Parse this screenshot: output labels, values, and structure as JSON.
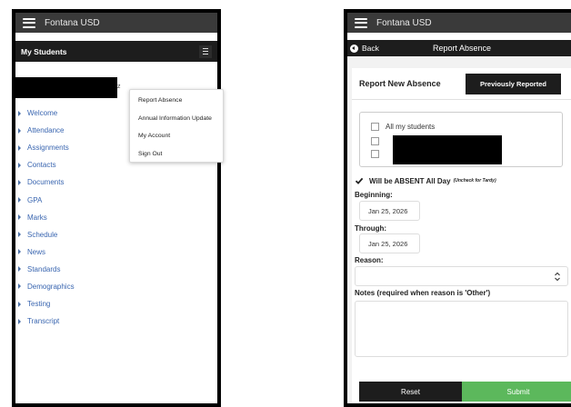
{
  "app": {
    "title": "Fontana USD"
  },
  "left": {
    "header_title": "My Students",
    "redacted_trailing_char": "z",
    "nav_items": [
      "Welcome",
      "Attendance",
      "Assignments",
      "Contacts",
      "Documents",
      "GPA",
      "Marks",
      "Schedule",
      "News",
      "Standards",
      "Demographics",
      "Testing",
      "Transcript"
    ],
    "dropdown_items": [
      "Report Absence",
      "Annual Information Update",
      "My Account",
      "Sign Out"
    ],
    "icons": {
      "menu": "hamburger-icon",
      "toggle": "menu-toggle-icon",
      "caret": "caret-right-icon"
    }
  },
  "right": {
    "back_label": "Back",
    "screen_title": "Report Absence",
    "report_title": "Report New Absence",
    "previously_reported_label": "Previously Reported",
    "all_students_label": "All my students",
    "absent_label": "Will be ABSENT All Day",
    "tardy_note": "(Uncheck for Tardy)",
    "beginning_label": "Beginning:",
    "beginning_value": "Jan 25, 2026",
    "through_label": "Through:",
    "through_value": "Jan 25, 2026",
    "reason_label": "Reason:",
    "reason_value": "",
    "notes_label": "Notes (required when reason is 'Other')",
    "notes_value": "",
    "reset_label": "Reset",
    "submit_label": "Submit",
    "icons": {
      "back": "back-arrow-icon",
      "check": "check-icon",
      "select": "select-arrows-icon"
    },
    "colors": {
      "submit": "#5cb85c",
      "dark": "#1d1d1d"
    }
  }
}
